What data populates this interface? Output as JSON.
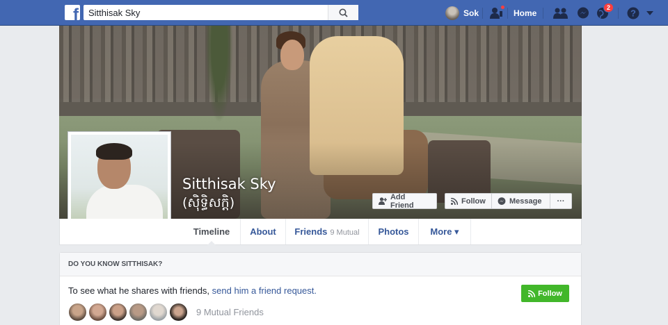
{
  "topbar": {
    "search_value": "Sitthisak Sky",
    "user_name": "Sok",
    "home_label": "Home",
    "notifications_count": "2"
  },
  "profile": {
    "name": "Sitthisak Sky",
    "alt_name": "(ស៊ិទ្ធិសក្តិ)"
  },
  "cover_actions": {
    "add_friend": "Add Friend",
    "follow": "Follow",
    "message": "Message",
    "more": "···"
  },
  "tabs": [
    {
      "label": "Timeline"
    },
    {
      "label": "About"
    },
    {
      "label": "Friends",
      "sub": "9 Mutual"
    },
    {
      "label": "Photos"
    },
    {
      "label": "More ▾"
    }
  ],
  "know_box": {
    "title": "DO YOU KNOW SITTHISAK?",
    "text": "To see what he shares with friends, ",
    "link": "send him a friend request.",
    "follow_label": "Follow",
    "mutual_label": "9 Mutual Friends"
  },
  "colors": {
    "brand": "#4267b2",
    "link": "#365899",
    "green": "#42b72a",
    "badge": "#fa3e3e"
  }
}
